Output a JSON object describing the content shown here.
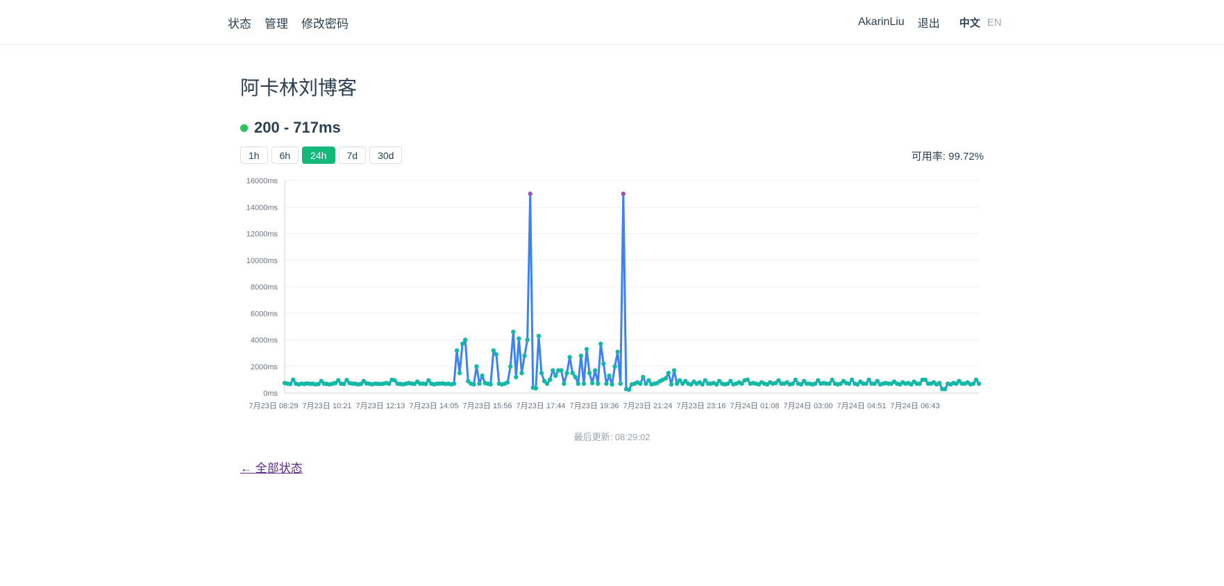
{
  "nav": {
    "items": [
      "状态",
      "管理",
      "修改密码"
    ],
    "user": "AkarinLiu",
    "logout": "退出",
    "lang_zh": "中文",
    "lang_en": "EN"
  },
  "page": {
    "title": "阿卡林刘博客",
    "status_text": "200 - 717ms",
    "status_color": "#22c55e",
    "availability": "可用率: 99.72%",
    "last_update": "最后更新: 08:29:02",
    "back_link": "← 全部状态"
  },
  "range_buttons": [
    {
      "label": "1h",
      "active": false
    },
    {
      "label": "6h",
      "active": false
    },
    {
      "label": "24h",
      "active": true
    },
    {
      "label": "7d",
      "active": false
    },
    {
      "label": "30d",
      "active": false
    }
  ],
  "colors": {
    "accent": "#14b87a",
    "line": "#3b82f6",
    "point": "#14b8a6",
    "point_timeout": "#9b59b6"
  },
  "chart_data": {
    "type": "line",
    "title": "",
    "xlabel": "",
    "ylabel": "",
    "ylim": [
      0,
      16000
    ],
    "y_ticks": [
      "0ms",
      "2000ms",
      "4000ms",
      "6000ms",
      "8000ms",
      "10000ms",
      "12000ms",
      "14000ms",
      "16000ms"
    ],
    "x_tick_labels": [
      "7月23日 08:29",
      "7月23日 10:21",
      "7月23日 12:13",
      "7月23日 14:05",
      "7月23日 15:56",
      "7月23日 17:44",
      "7月23日 19:36",
      "7月23日 21:24",
      "7月23日 23:16",
      "7月24日 01:08",
      "7月24日 03:00",
      "7月24日 04:51",
      "7月24日 06:43"
    ],
    "grid": true,
    "series": [
      {
        "values": [
          750,
          700,
          680,
          1000,
          700,
          650,
          700,
          680,
          720,
          690,
          700,
          650,
          680,
          900,
          700,
          680,
          650,
          700,
          750,
          950,
          700,
          680,
          980,
          750,
          700,
          700,
          650,
          680,
          900,
          720,
          700,
          650,
          700,
          690,
          680,
          700,
          750,
          700,
          1000,
          950,
          700,
          680,
          650,
          700,
          750,
          700,
          680,
          850,
          700,
          700,
          680,
          950,
          700,
          650,
          700,
          700,
          720,
          680,
          700,
          650,
          700,
          3200,
          1500,
          3700,
          4000,
          900,
          700,
          650,
          2000,
          700,
          1300,
          750,
          700,
          650,
          3200,
          2900,
          700,
          650,
          700,
          800,
          2000,
          4600,
          1200,
          4100,
          1500,
          2800,
          4000,
          15000,
          400,
          350,
          4300,
          1500,
          900,
          700,
          1000,
          1700,
          1300,
          1700,
          1700,
          700,
          1500,
          2700,
          1500,
          1200,
          700,
          2800,
          700,
          3300,
          1500,
          750,
          1700,
          700,
          3700,
          2200,
          700,
          1300,
          650,
          2000,
          3100,
          700,
          15000,
          300,
          250,
          650,
          700,
          800,
          700,
          1200,
          700,
          950,
          650,
          700,
          750,
          900,
          1000,
          1100,
          1500,
          650,
          1700,
          700,
          950,
          700,
          900,
          700,
          650,
          850,
          700,
          800,
          650,
          950,
          700,
          700,
          750,
          650,
          900,
          700,
          650,
          700,
          900,
          650,
          700,
          800,
          700,
          950,
          1000,
          700,
          750,
          700,
          650,
          800,
          700,
          650,
          800,
          700,
          750,
          950,
          700,
          700,
          800,
          650,
          700,
          1000,
          700,
          650,
          900,
          700,
          700,
          650,
          700,
          950,
          700,
          750,
          700,
          700,
          1000,
          700,
          650,
          700,
          900,
          750,
          700,
          1000,
          700,
          650,
          850,
          700,
          700,
          1000,
          700,
          700,
          900,
          650,
          700,
          750,
          700,
          700,
          850,
          700,
          650,
          800,
          700,
          750,
          650,
          850,
          700,
          700,
          1000,
          1000,
          700,
          700,
          800,
          650,
          750,
          300,
          300,
          700,
          650,
          750,
          700,
          900,
          700,
          700,
          800,
          650,
          700,
          1000,
          700
        ]
      }
    ]
  }
}
